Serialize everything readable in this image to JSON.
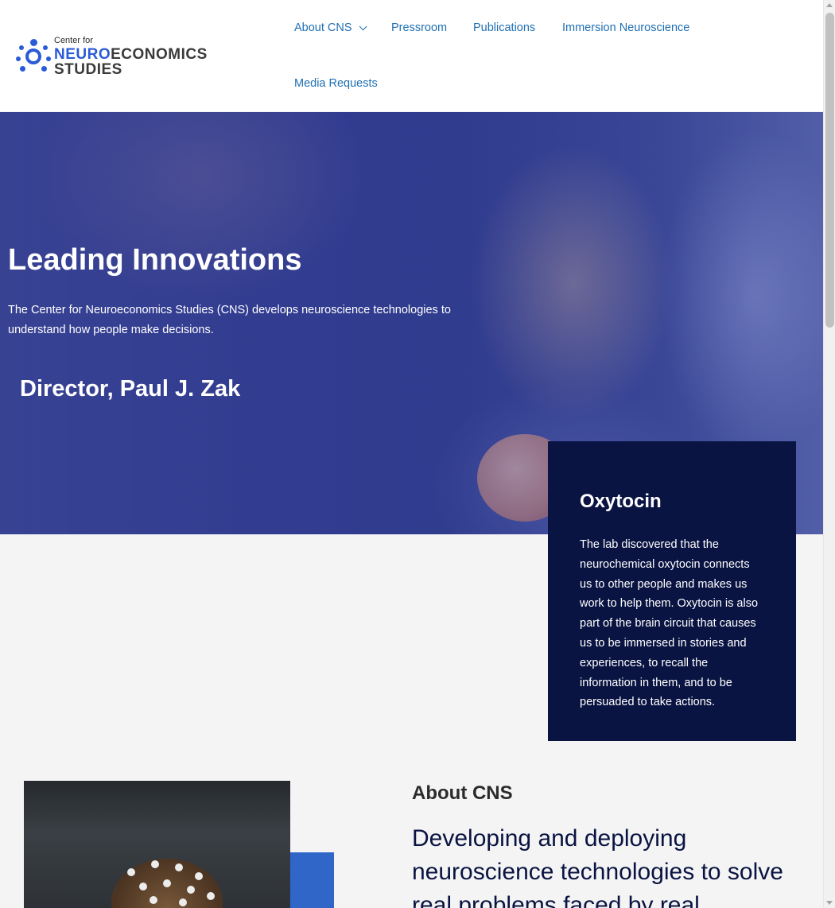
{
  "header": {
    "logo": {
      "line_small": "Center for",
      "line_big_a": "NEURO",
      "line_big_b": "ECONOMICS STUDIES",
      "brand_color": "#2a5bd7"
    },
    "nav": [
      {
        "label": "About CNS",
        "has_dropdown": true
      },
      {
        "label": "Pressroom"
      },
      {
        "label": "Publications"
      },
      {
        "label": "Immersion Neuroscience"
      },
      {
        "label": "Media Requests"
      }
    ],
    "link_color": "#1f6fb2"
  },
  "hero": {
    "title": "Leading Innovations",
    "description": "The Center for Neuroeconomics Studies (CNS) develops neuroscience technologies to understand how people make decisions.",
    "director": "Director, Paul J. Zak",
    "overlay_color": "#3a4594"
  },
  "card": {
    "title": "Oxytocin",
    "text": "The lab discovered that the neurochemical oxytocin connects us to other people and makes us work to help them. Oxytocin is also part of the brain circuit that causes us to be immersed in stories and experiences, to recall the information in them, and to be persuaded to take actions.",
    "background": "#0a1442"
  },
  "about": {
    "label": "About CNS",
    "headline": "Developing and deploying neuroscience technologies to solve real problems faced by real",
    "accent": "#2f66c8"
  }
}
